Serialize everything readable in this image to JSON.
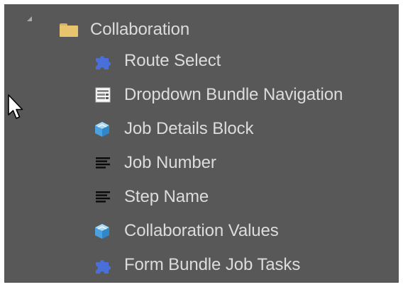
{
  "tree": {
    "folder": {
      "label": "Collaboration",
      "icon": "folder-icon",
      "expanded": true
    },
    "children": [
      {
        "label": "Route Select",
        "icon": "puzzle-icon"
      },
      {
        "label": "Dropdown Bundle Navigation",
        "icon": "form-icon"
      },
      {
        "label": "Job Details Block",
        "icon": "cube-icon"
      },
      {
        "label": "Job Number",
        "icon": "text-lines-icon"
      },
      {
        "label": "Step Name",
        "icon": "text-lines-icon"
      },
      {
        "label": "Collaboration Values",
        "icon": "cube-icon"
      },
      {
        "label": "Form Bundle Job Tasks",
        "icon": "puzzle-icon"
      }
    ]
  },
  "colors": {
    "panel_background": "#585858",
    "text": "#dcdcdc",
    "folder": "#e8c46f",
    "puzzle": "#4a6fd8",
    "cube": "#5aaee8"
  }
}
